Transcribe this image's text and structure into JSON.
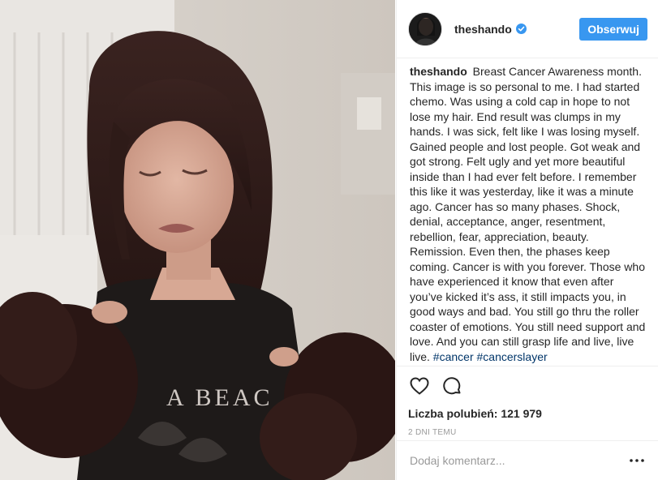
{
  "post": {
    "username": "theshando",
    "follow_label": "Obserwuj",
    "caption_user": "theshando",
    "caption_text": "Breast Cancer Awareness month. This image is so personal to me. I had started chemo. Was using a cold cap in hope to not lose my hair. End result was clumps in my hands. I was sick, felt like I was losing myself. Gained people and lost people. Got weak and got strong. Felt ugly and yet more beautiful inside than I had ever felt before. I remember this like it was yesterday, like it was a minute ago. Cancer has so many phases. Shock, denial, acceptance, anger, resentment, rebellion, fear, appreciation, beauty. Remission. Even then, the phases keep coming. Cancer is with you forever. Those who have experienced it know that even after you’ve kicked it’s ass, it still impacts you, in good ways and bad. You still go thru the roller coaster of emotions. You still need support and love. And you can still grasp life and live, live live.",
    "hashtags": [
      "#cancer",
      "#cancerslayer"
    ],
    "likes_label": "Liczba polubień: 121 979",
    "time_label": "2 DNI TEMU",
    "comment_placeholder": "Dodaj komentarz..."
  },
  "photo": {
    "shirt_text": "A BEAC"
  },
  "icons": {
    "verified": "verified-badge-icon",
    "like": "heart-icon",
    "comment": "comment-bubble-icon",
    "more": "more-options-icon"
  },
  "colors": {
    "accent": "#3897f0",
    "hashtag": "#003569",
    "border": "#efefef",
    "muted": "#999999"
  }
}
